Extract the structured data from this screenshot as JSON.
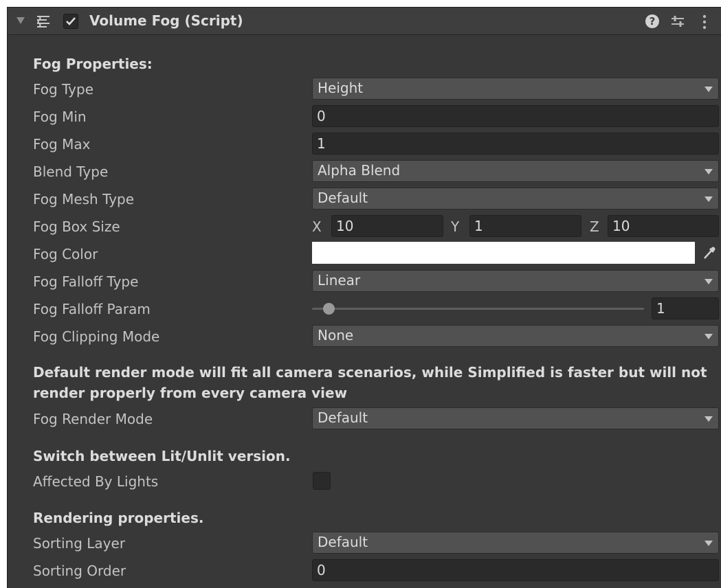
{
  "header": {
    "title": "Volume Fog (Script)",
    "enabled": true,
    "icons": [
      "foldout-arrow-icon",
      "script-icon",
      "checkbox-checked-icon",
      "help-icon",
      "presets-icon",
      "context-menu-icon"
    ]
  },
  "sections": {
    "fog_properties": "Fog Properties:",
    "render_help": "Default render mode will fit all camera scenarios, while Simplified is faster but will not render properly from every camera view",
    "lit_help": "Switch between Lit/Unlit version.",
    "rendering": "Rendering properties."
  },
  "fields": {
    "fog_type": {
      "label": "Fog Type",
      "value": "Height"
    },
    "fog_min": {
      "label": "Fog Min",
      "value": "0"
    },
    "fog_max": {
      "label": "Fog Max",
      "value": "1"
    },
    "blend_type": {
      "label": "Blend Type",
      "value": "Alpha Blend"
    },
    "fog_mesh_type": {
      "label": "Fog Mesh Type",
      "value": "Default"
    },
    "fog_box_size": {
      "label": "Fog Box Size",
      "x_label": "X",
      "x": "10",
      "y_label": "Y",
      "y": "1",
      "z_label": "Z",
      "z": "10"
    },
    "fog_color": {
      "label": "Fog Color",
      "value": "#ffffff"
    },
    "fog_falloff_type": {
      "label": "Fog Falloff Type",
      "value": "Linear"
    },
    "fog_falloff_param": {
      "label": "Fog Falloff Param",
      "value": "1",
      "slider_fraction": 0.03
    },
    "fog_clipping_mode": {
      "label": "Fog Clipping Mode",
      "value": "None"
    },
    "fog_render_mode": {
      "label": "Fog Render Mode",
      "value": "Default"
    },
    "affected_by_lights": {
      "label": "Affected By Lights",
      "checked": false
    },
    "sorting_layer": {
      "label": "Sorting Layer",
      "value": "Default"
    },
    "sorting_order": {
      "label": "Sorting Order",
      "value": "0"
    }
  },
  "colors": {
    "panel_bg": "#383838",
    "header_bg": "#3e3e3e",
    "dropdown_bg": "#515151",
    "field_bg": "#2a2a2a",
    "text": "#c4c4c4"
  }
}
